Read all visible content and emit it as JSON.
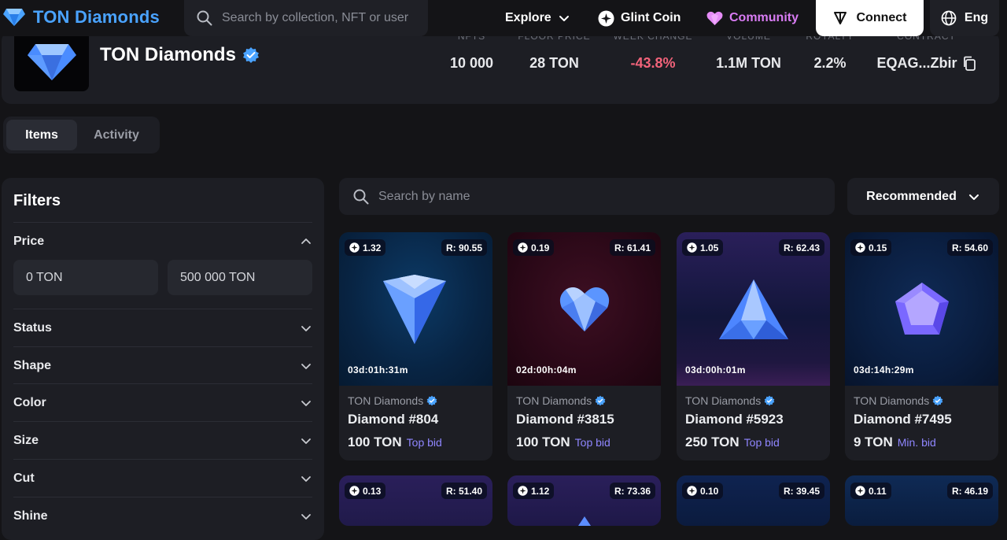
{
  "header": {
    "logo_text": "TON Diamonds",
    "search_placeholder": "Search by collection, NFT or user",
    "nav_explore": "Explore",
    "nav_glint": "Glint Coin",
    "nav_community": "Community",
    "connect_label": "Connect",
    "lang_label": "Eng",
    "community_color": "#d97cf4"
  },
  "collection": {
    "title": "TON Diamonds",
    "stats": [
      {
        "label": "NFTS",
        "value": "10 000"
      },
      {
        "label": "FLOOR PRICE",
        "value": "28 TON"
      },
      {
        "label": "WEEK CHANGE",
        "value": "-43.8%",
        "color": "#f2637a"
      },
      {
        "label": "VOLUME",
        "value": "1.1M TON"
      },
      {
        "label": "ROYALTY",
        "value": "2.2%"
      },
      {
        "label": "CONTRACT",
        "value": "EQAG...Zbir"
      }
    ]
  },
  "tabs": {
    "items": "Items",
    "activity": "Activity"
  },
  "filters": {
    "title": "Filters",
    "price_label": "Price",
    "price_min": "0 TON",
    "price_max": "500 000 TON",
    "sections": [
      "Status",
      "Shape",
      "Color",
      "Size",
      "Cut",
      "Shine"
    ]
  },
  "list": {
    "search_placeholder": "Search by name",
    "sort_label": "Recommended"
  },
  "cards": [
    {
      "left": "1.32",
      "rarity": "R: 90.55",
      "timer": "03d:01h:31m",
      "collection": "TON Diamonds",
      "name": "Diamond #804",
      "price": "100 TON",
      "price_type": "Top bid",
      "shape": "diamond-icon",
      "bg": "blue"
    },
    {
      "left": "0.19",
      "rarity": "R: 61.41",
      "timer": "02d:00h:04m",
      "collection": "TON Diamonds",
      "name": "Diamond #3815",
      "price": "100 TON",
      "price_type": "Top bid",
      "shape": "heart-gem-icon",
      "bg": "red"
    },
    {
      "left": "1.05",
      "rarity": "R: 62.43",
      "timer": "03d:00h:01m",
      "collection": "TON Diamonds",
      "name": "Diamond #5923",
      "price": "250 TON",
      "price_type": "Top bid",
      "shape": "triangle-gem-icon",
      "bg": "purple"
    },
    {
      "left": "0.15",
      "rarity": "R: 54.60",
      "timer": "03d:14h:29m",
      "collection": "TON Diamonds",
      "name": "Diamond #7495",
      "price": "9 TON",
      "price_type": "Min. bid",
      "shape": "pentagon-gem-icon",
      "bg": "navy"
    },
    {
      "left": "0.13",
      "rarity": "R: 51.40",
      "bg": "purple"
    },
    {
      "left": "1.12",
      "rarity": "R: 73.36",
      "bg": "purple"
    },
    {
      "left": "0.10",
      "rarity": "R: 39.45",
      "bg": "navy"
    },
    {
      "left": "0.11",
      "rarity": "R: 46.19",
      "bg": "navy"
    }
  ]
}
